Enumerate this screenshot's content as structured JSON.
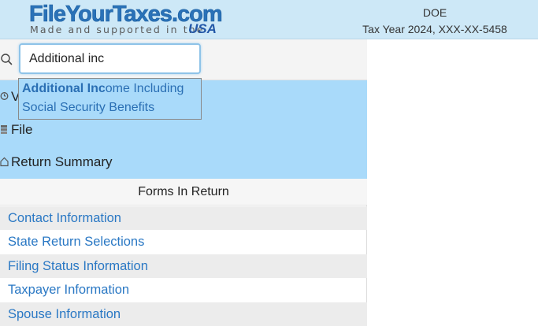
{
  "header": {
    "logo_main": "FileYourTaxes.com",
    "logo_sub": "Made and supported in the",
    "logo_usa": "USA",
    "user_name": "DOE",
    "tax_info": "Tax Year 2024, XXX-XX-5458"
  },
  "search": {
    "icon": "search-icon",
    "value": "Additional inc"
  },
  "autocomplete": {
    "match": "Additional Inc",
    "rest": "ome Including Social Security Benefits"
  },
  "nav": {
    "items": [
      {
        "label": "V",
        "icon": "history-icon"
      },
      {
        "label": "File",
        "icon": "file-stack-icon"
      },
      {
        "label": "Return Summary",
        "icon": "home-icon"
      }
    ]
  },
  "forms": {
    "header": "Forms In Return",
    "items": [
      "Contact Information",
      "State Return Selections",
      "Filing Status Information",
      "Taxpayer Information",
      "Spouse Information"
    ]
  },
  "colors": {
    "header_bg": "#cde8f7",
    "nav_bg": "#a9dafa",
    "link": "#2a78c4"
  }
}
